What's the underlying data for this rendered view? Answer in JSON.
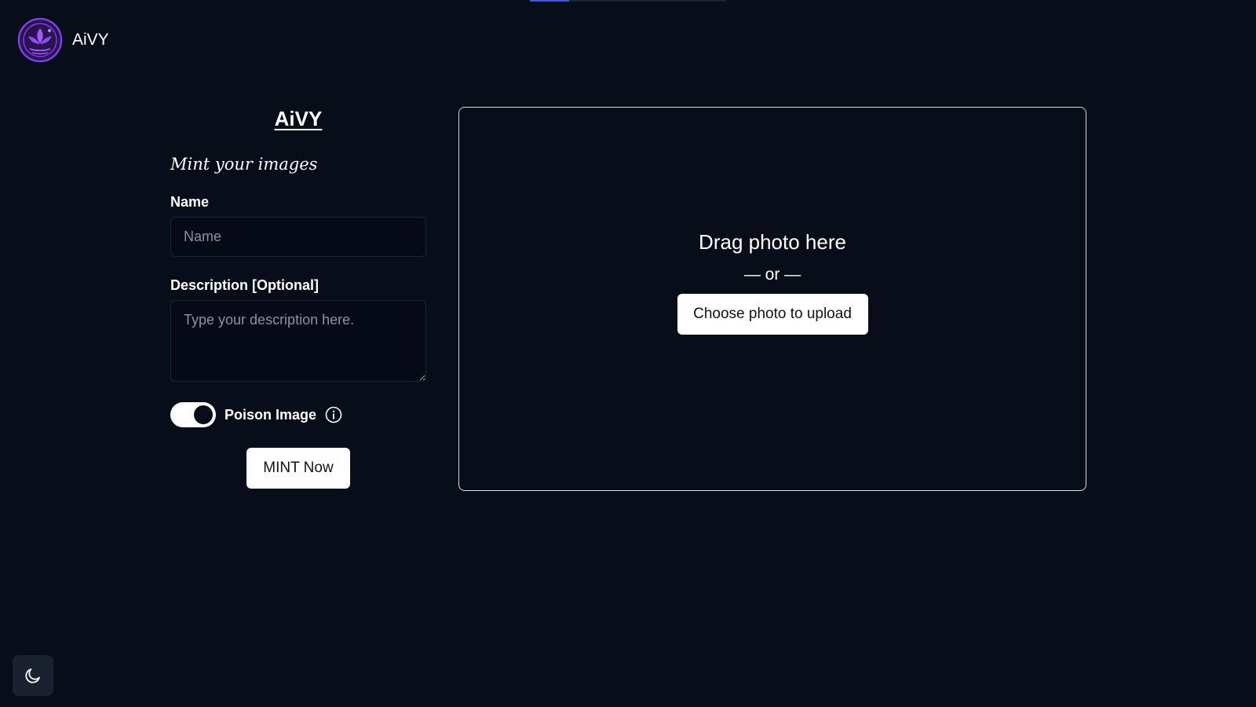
{
  "header": {
    "brand": "AiVY",
    "logo_icon": "lotus-globe-logo",
    "logo_color": "#7b3fe4"
  },
  "form": {
    "title": "AiVY",
    "subtitle": "Mint your images",
    "name_label": "Name",
    "name_placeholder": "Name",
    "name_value": "",
    "description_label": "Description [Optional]",
    "description_placeholder": "Type your description here.",
    "description_value": "",
    "poison_label": "Poison Image",
    "poison_enabled": true,
    "mint_button": "MINT Now"
  },
  "dropzone": {
    "title": "Drag photo here",
    "separator": "— or —",
    "upload_button": "Choose photo to upload"
  },
  "theme": {
    "icon": "moon-icon"
  },
  "colors": {
    "background": "#080d1a",
    "accent_purple": "#7b3fe4",
    "toggle_on": "#ffffff"
  }
}
